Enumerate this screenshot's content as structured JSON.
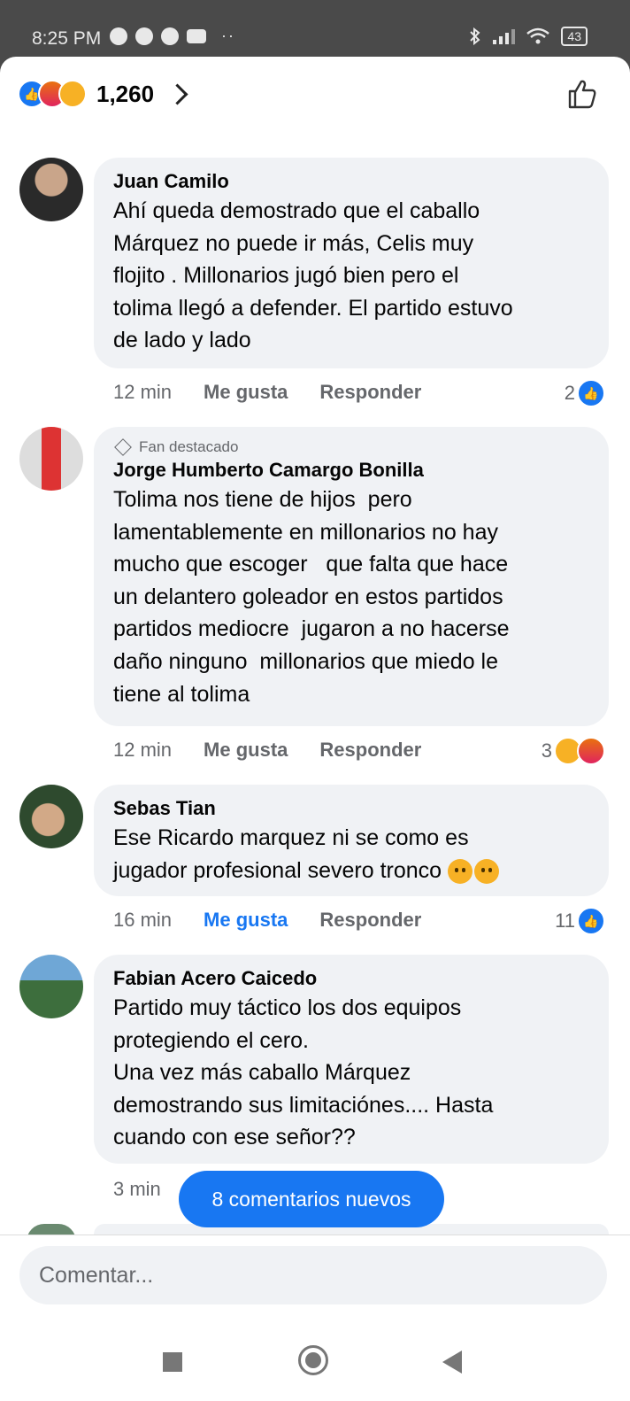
{
  "status_bar": {
    "time": "8:25 PM",
    "more": "··",
    "battery": "43"
  },
  "reactions": {
    "count": "1,260"
  },
  "comments": [
    {
      "name": "Juan Camilo",
      "text": "Ahí queda demostrado que el caballo\nMárquez no puede ir más, Celis muy\nflojito . Millonarios jugó bien pero el\ntolima llegó a defender. El partido estuvo\nde lado y lado",
      "time": "12 min",
      "like": "Me gusta",
      "reply": "Responder",
      "reaction_count": "2"
    },
    {
      "badge": "Fan destacado",
      "name": "Jorge Humberto Camargo Bonilla",
      "text": "Tolima nos tiene de hijos  pero\nlamentablemente en millonarios no hay\nmucho que escoger   que falta que hace\nun delantero goleador en estos partidos\npartidos mediocre  jugaron a no hacerse\ndaño ninguno  millonarios que miedo le\ntiene al tolima",
      "time": "12 min",
      "like": "Me gusta",
      "reply": "Responder",
      "reaction_count": "3"
    },
    {
      "name": "Sebas Tian",
      "text_line1": "Ese Ricardo marquez ni se como es",
      "text_line2": "jugador profesional severo tronco",
      "time": "16 min",
      "like": "Me gusta",
      "reply": "Responder",
      "reaction_count": "11"
    },
    {
      "name": "Fabian Acero Caicedo",
      "text": "Partido muy táctico los dos equipos\nprotegiendo el cero.\nUna vez más caballo Márquez\ndemostrando sus limitaciónes.... Hasta\ncuando con ese señor??",
      "time": "3 min"
    }
  ],
  "new_comments_label": "8 comentarios nuevos",
  "composer": {
    "placeholder": "Comentar..."
  },
  "colors": {
    "accent": "#1877f2",
    "bubble": "#f0f2f5",
    "secondary_text": "#65676b"
  }
}
